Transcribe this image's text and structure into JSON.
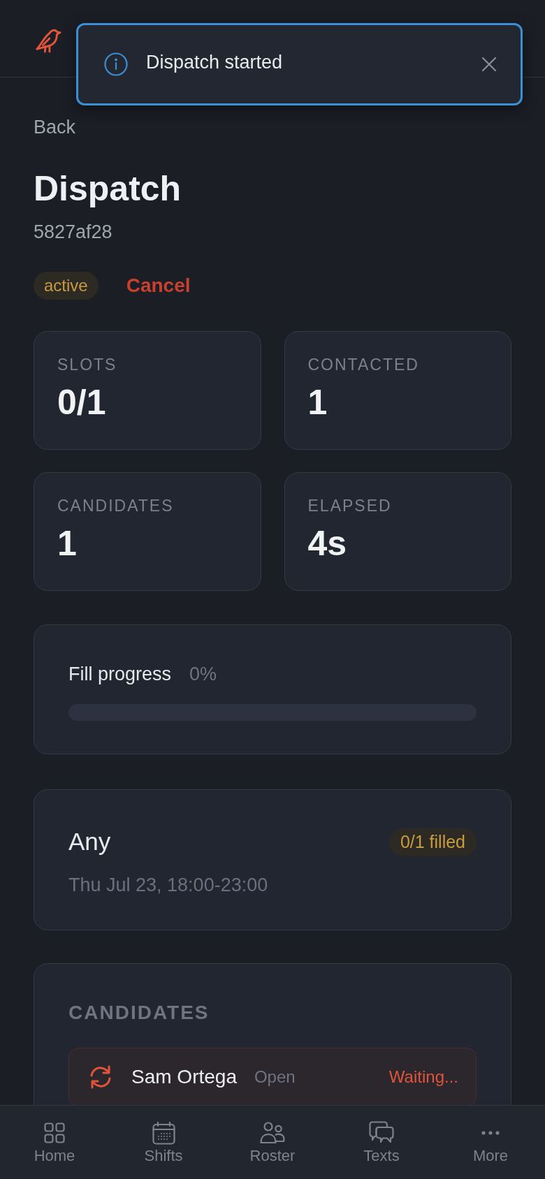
{
  "toast": {
    "kind": "info",
    "message": "Dispatch started"
  },
  "back_link": "Back",
  "title": "Dispatch",
  "dispatch_id": "5827af28",
  "status_badge": "active",
  "cancel_button": "Cancel",
  "stats": [
    {
      "label": "SLOTS",
      "value": "0/1"
    },
    {
      "label": "CONTACTED",
      "value": "1"
    },
    {
      "label": "CANDIDATES",
      "value": "1"
    },
    {
      "label": "ELAPSED",
      "value": "4s"
    }
  ],
  "fill_progress": {
    "label": "Fill progress",
    "reading": "0%",
    "level": 0
  },
  "slot": {
    "role": "Any",
    "badge": "0/1 filled",
    "time": "Thu Jul 23, 18:00-23:00"
  },
  "candidates": {
    "heading": "CANDIDATES",
    "rows": [
      {
        "name": "Sam Ortega",
        "channel": "Open",
        "status": "Waiting..."
      }
    ]
  },
  "bottom_nav": [
    {
      "label": "Home",
      "selected": false
    },
    {
      "label": "Shifts",
      "selected": false
    },
    {
      "label": "Roster",
      "selected": false
    },
    {
      "label": "Texts",
      "selected": false
    },
    {
      "label": "More",
      "selected": false
    }
  ]
}
